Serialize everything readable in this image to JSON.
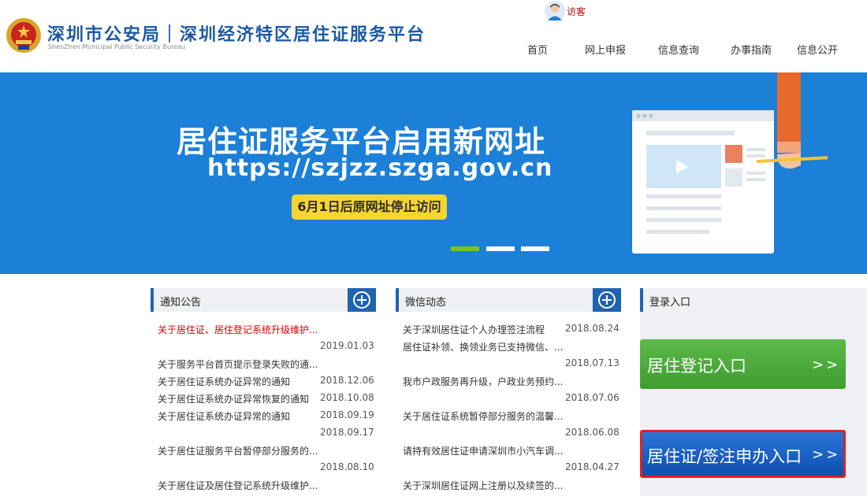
{
  "header": {
    "title": "深圳市公安局｜深圳经济特区居住证服务平台",
    "subtitle": "ShenZhen Municipal Public Security Bureau",
    "user_label": "访客",
    "nav": [
      "首页",
      "网上申报",
      "信息查询",
      "办事指南",
      "信息公开"
    ]
  },
  "banner": {
    "title": "居住证服务平台启用新网址",
    "url": "https://szjzz.szga.gov.cn",
    "note": "6月1日后原网址停止访问",
    "slides": 3,
    "active_slide": 1
  },
  "notice": {
    "title": "通知公告",
    "lines": [
      {
        "text": "关于居住证、居住登记系统升级维护...",
        "date": ""
      },
      {
        "text": "",
        "date": "2019.01.03"
      },
      {
        "text": "关于服务平台首页提示登录失败的通...",
        "date": ""
      },
      {
        "text": "关于居住证系统办证异常的通知",
        "date": "2018.12.06"
      },
      {
        "text": "关于居住证系统办证异常恢复的通知",
        "date": "2018.10.08"
      },
      {
        "text": "关于居住证系统办证异常的通知",
        "date": "2018.09.19"
      },
      {
        "text": "",
        "date": "2018.09.17"
      },
      {
        "text": "关于居住证服务平台暂停部分服务的...",
        "date": ""
      },
      {
        "text": "",
        "date": "2018.08.10"
      },
      {
        "text": "关于居住证及居住登记系统升级维护...",
        "date": ""
      }
    ]
  },
  "wechat": {
    "title": "微信动态",
    "lines": [
      {
        "text": "关于深圳居住证个人办理签注流程",
        "date": "2018.08.24"
      },
      {
        "text": "居住证补领、换领业务已支持微信、...",
        "date": ""
      },
      {
        "text": "",
        "date": "2018.07.13"
      },
      {
        "text": "我市户政服务再升级，户政业务预约...",
        "date": ""
      },
      {
        "text": "",
        "date": "2018.07.06"
      },
      {
        "text": "关于居住证系统暂停部分服务的温馨...",
        "date": ""
      },
      {
        "text": "",
        "date": "2018.06.08"
      },
      {
        "text": "请持有效居住证申请深圳市小汽车调...",
        "date": ""
      },
      {
        "text": "",
        "date": "2018.04.27"
      },
      {
        "text": "关于深圳居住证网上注册以及续签的...",
        "date": ""
      }
    ]
  },
  "login": {
    "title": "登录入口",
    "btn_register": "居住登记入口",
    "btn_apply": "居住证/签注申办入口",
    "arrow": ">>"
  },
  "colors": {
    "brand_blue": "#1c5aa6",
    "banner_bg": "#1c7fd8",
    "panel_accent": "#1f63b1",
    "btn_green": "#4caf3c",
    "btn_blue": "#0d4fae",
    "highlight_red": "#d40000",
    "note_yellow": "#f6d62e"
  }
}
